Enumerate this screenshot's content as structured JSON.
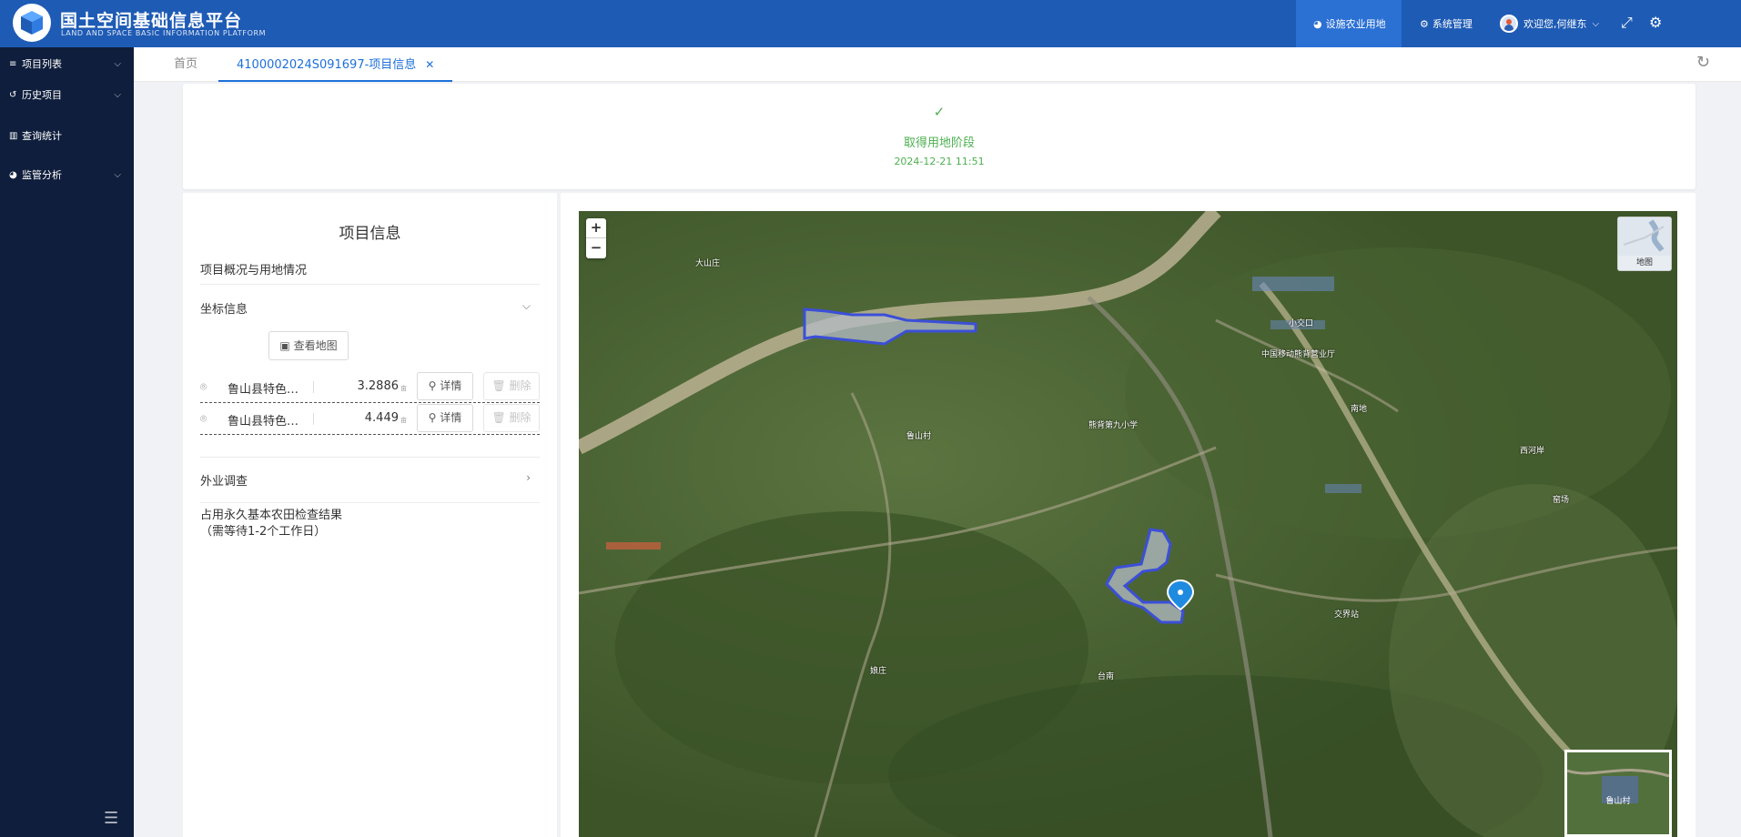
{
  "header": {
    "title": "国土空间基础信息平台",
    "subtitle": "LAND AND SPACE BASIC INFORMATION PLATFORM",
    "nav_active": "设施农业用地",
    "nav_system": "系统管理",
    "welcome": "欢迎您,何继东"
  },
  "sidebar": {
    "items": [
      {
        "label": "项目列表"
      },
      {
        "label": "历史项目"
      },
      {
        "label": "查询统计"
      },
      {
        "label": "监管分析"
      }
    ]
  },
  "tabs": {
    "home": "首页",
    "active": "4100002024S091697-项目信息"
  },
  "stage": {
    "name": "取得用地阶段",
    "time": "2024-12-21 11:51"
  },
  "info": {
    "title": "项目信息",
    "overview": "项目概况与用地情况",
    "coord_section": "坐标信息",
    "view_map": "查看地图",
    "coords": [
      {
        "name": "鲁山县特色…",
        "area": "3.2886",
        "unit": "亩",
        "detail": "详情",
        "delete": "删除"
      },
      {
        "name": "鲁山县特色…",
        "area": "4.449",
        "unit": "亩",
        "detail": "详情",
        "delete": "删除"
      }
    ],
    "field_survey": "外业调查",
    "farmland_line1": "占用永久基本农田检查结果",
    "farmland_line2": "（需等待1-2个工作日）"
  },
  "map": {
    "basemap_label": "地图",
    "overview_label": "鲁山村",
    "labels": [
      {
        "text": "大山庄"
      },
      {
        "text": "小交口"
      },
      {
        "text": "中国移动熊背营业厅"
      },
      {
        "text": "熊背第九小学"
      },
      {
        "text": "南地"
      },
      {
        "text": "西河岸"
      },
      {
        "text": "窑场"
      },
      {
        "text": "交界站"
      },
      {
        "text": "台南"
      },
      {
        "text": "娘庄"
      },
      {
        "text": "鲁山村"
      }
    ]
  }
}
